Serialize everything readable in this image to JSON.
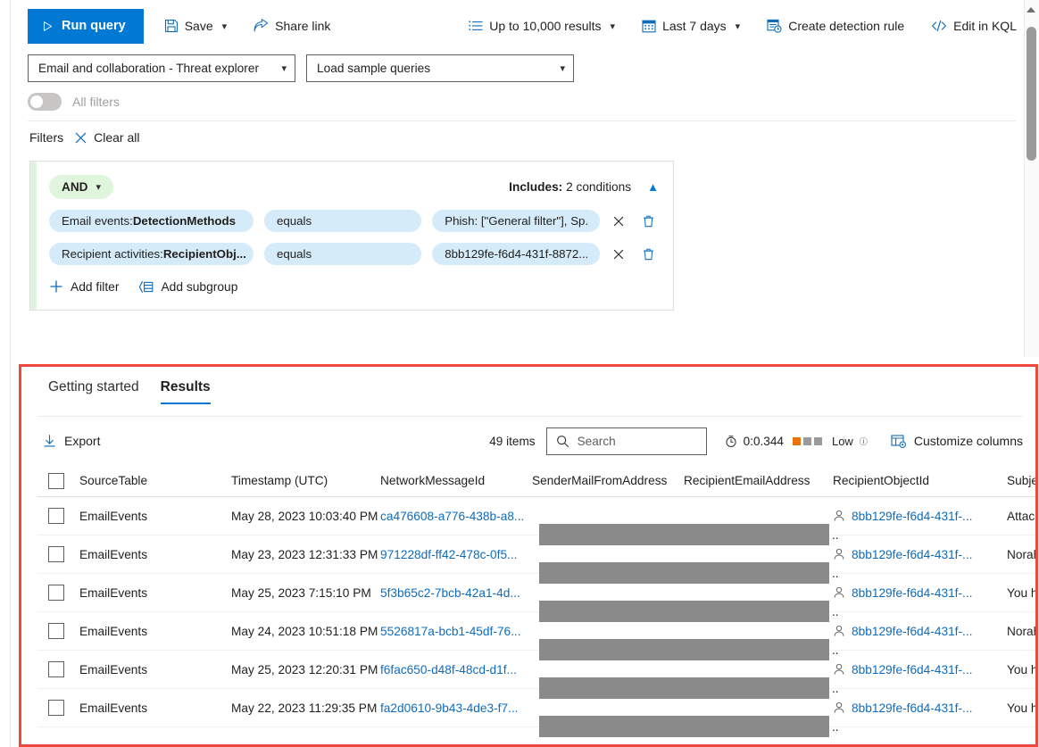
{
  "toolbar": {
    "run_query": "Run query",
    "save": "Save",
    "share_link": "Share link",
    "results_limit": "Up to 10,000 results",
    "time_range": "Last 7 days",
    "create_detection_rule": "Create detection rule",
    "edit_in_kql": "Edit in KQL"
  },
  "pickers": {
    "data_source": "Email and collaboration - Threat explorer",
    "sample_queries": "Load sample queries"
  },
  "all_filters": {
    "label": "All filters",
    "state": "off"
  },
  "filters": {
    "title": "Filters",
    "clear_all": "Clear all",
    "group": {
      "operator": "AND",
      "includes_label": "Includes:",
      "includes_value": "2 conditions",
      "conditions": [
        {
          "field_prefix": "Email events: ",
          "field_name": "DetectionMethods",
          "operator": "equals",
          "value": "Phish: [\"General filter\"], Sp..."
        },
        {
          "field_prefix": "Recipient activities: ",
          "field_name": "RecipientObj...",
          "operator": "equals",
          "value": "8bb129fe-f6d4-431f-8872..."
        }
      ],
      "add_filter": "Add filter",
      "add_subgroup": "Add subgroup"
    }
  },
  "results": {
    "tabs": [
      {
        "label": "Getting started",
        "active": false
      },
      {
        "label": "Results",
        "active": true
      }
    ],
    "export": "Export",
    "items_count": "49 items",
    "search_placeholder": "Search",
    "perf_time": "0:0.344",
    "perf_level": "Low",
    "customize_columns": "Customize columns",
    "accent_color": "#0078d4",
    "highlight_color": "#f0473e",
    "perf_bar_color": "#e8730c",
    "perf_bar_inactive": "#9a9a9a",
    "table": {
      "columns": [
        "SourceTable",
        "Timestamp (UTC)",
        "NetworkMessageId",
        "SenderMailFromAddress",
        "RecipientEmailAddress",
        "RecipientObjectId",
        "Subject"
      ],
      "rows": [
        {
          "source_table": "EmailEvents",
          "timestamp": "May 28, 2023 10:03:40 PM",
          "network_message_id": "ca476608-a776-438b-a8...",
          "sender_mail_from_address": "",
          "recipient_email_address": "..",
          "recipient_object_id": "8bb129fe-f6d4-431f-...",
          "subject": "Attach"
        },
        {
          "source_table": "EmailEvents",
          "timestamp": "May 23, 2023 12:31:33 PM",
          "network_message_id": "971228df-ff42-478c-0f5...",
          "sender_mail_from_address": "",
          "recipient_email_address": "..",
          "recipient_object_id": "8bb129fe-f6d4-431f-...",
          "subject": "Norah"
        },
        {
          "source_table": "EmailEvents",
          "timestamp": "May 25, 2023 7:15:10 PM",
          "network_message_id": "5f3b65c2-7bcb-42a1-4d...",
          "sender_mail_from_address": "",
          "recipient_email_address": "..",
          "recipient_object_id": "8bb129fe-f6d4-431f-...",
          "subject": "You ha"
        },
        {
          "source_table": "EmailEvents",
          "timestamp": "May 24, 2023 10:51:18 PM",
          "network_message_id": "5526817a-bcb1-45df-76...",
          "sender_mail_from_address": "",
          "recipient_email_address": "..",
          "recipient_object_id": "8bb129fe-f6d4-431f-...",
          "subject": "Norah"
        },
        {
          "source_table": "EmailEvents",
          "timestamp": "May 25, 2023 12:20:31 PM",
          "network_message_id": "f6fac650-d48f-48cd-d1f...",
          "sender_mail_from_address": "",
          "recipient_email_address": "..",
          "recipient_object_id": "8bb129fe-f6d4-431f-...",
          "subject": "You ha"
        },
        {
          "source_table": "EmailEvents",
          "timestamp": "May 22, 2023 11:29:35 PM",
          "network_message_id": "fa2d0610-9b43-4de3-f7...",
          "sender_mail_from_address": "",
          "recipient_email_address": "..",
          "recipient_object_id": "8bb129fe-f6d4-431f-...",
          "subject": "You ha"
        }
      ]
    }
  }
}
